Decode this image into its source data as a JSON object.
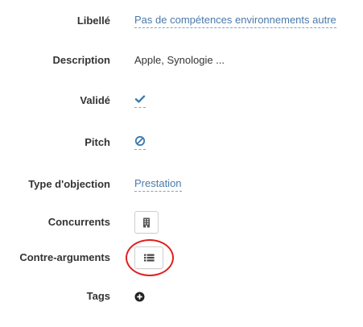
{
  "fields": {
    "libelle": {
      "label": "Libellé",
      "value": "Pas de compétences environnements autre"
    },
    "description": {
      "label": "Description",
      "value": "Apple, Synologie ..."
    },
    "valide": {
      "label": "Validé",
      "icon": "check-icon",
      "state": "checked"
    },
    "pitch": {
      "label": "Pitch",
      "icon": "ban-icon"
    },
    "type_objection": {
      "label": "Type d'objection",
      "value": "Prestation"
    },
    "concurrents": {
      "label": "Concurrents",
      "icon": "building-icon"
    },
    "contre_arguments": {
      "label": "Contre-arguments",
      "icon": "list-icon"
    },
    "tags": {
      "label": "Tags",
      "icon": "plus-circle-icon"
    }
  },
  "colors": {
    "link": "#4a7aab",
    "icon_blue": "#3f7ab0",
    "label": "#333333",
    "annotation": "#e11f1f"
  }
}
